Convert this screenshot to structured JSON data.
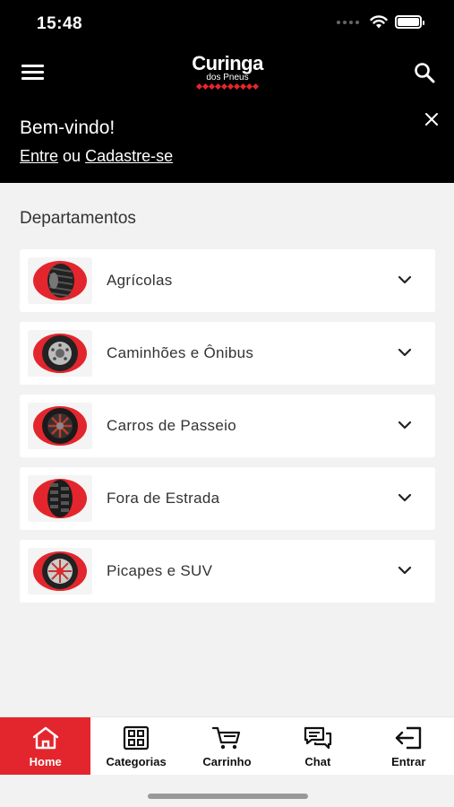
{
  "status_bar": {
    "time": "15:48"
  },
  "header": {
    "logo_main": "Curinga",
    "logo_sub": "dos Pneus"
  },
  "welcome": {
    "title": "Bem-vindo!",
    "login_link": "Entre",
    "separator": "ou",
    "signup_link": "Cadastre-se"
  },
  "departments": {
    "title": "Departamentos",
    "items": [
      {
        "label": "Agrícolas",
        "icon": "agricultural-tire-icon"
      },
      {
        "label": "Caminhões e Ônibus",
        "icon": "truck-tire-icon"
      },
      {
        "label": "Carros de Passeio",
        "icon": "car-tire-icon"
      },
      {
        "label": "Fora de Estrada",
        "icon": "offroad-tire-icon"
      },
      {
        "label": "Picapes e SUV",
        "icon": "suv-tire-icon"
      }
    ]
  },
  "tabbar": {
    "items": [
      {
        "label": "Home",
        "icon": "home-icon",
        "active": true
      },
      {
        "label": "Categorias",
        "icon": "grid-icon",
        "active": false
      },
      {
        "label": "Carrinho",
        "icon": "cart-icon",
        "active": false
      },
      {
        "label": "Chat",
        "icon": "chat-icon",
        "active": false
      },
      {
        "label": "Entrar",
        "icon": "login-icon",
        "active": false
      }
    ]
  },
  "colors": {
    "brand_red": "#e3262d",
    "header_bg": "#000000",
    "page_bg": "#f2f2f2"
  }
}
